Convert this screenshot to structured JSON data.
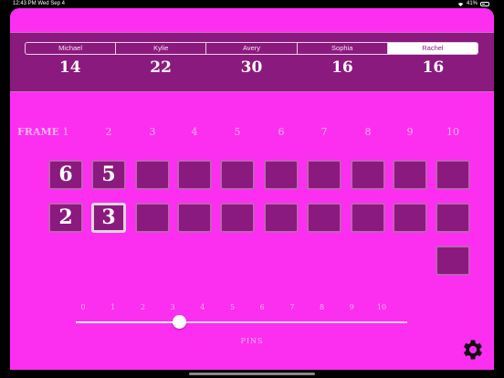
{
  "status": {
    "time": "12:43 PM",
    "date": "Wed Sep 4",
    "battery": "41%"
  },
  "players": [
    {
      "name": "Michael",
      "score": "14",
      "active": false
    },
    {
      "name": "Kylie",
      "score": "22",
      "active": false
    },
    {
      "name": "Avery",
      "score": "30",
      "active": false
    },
    {
      "name": "Sophia",
      "score": "16",
      "active": false
    },
    {
      "name": "Rachel",
      "score": "16",
      "active": true
    }
  ],
  "frames": {
    "label": "FRAME",
    "numbers": [
      "1",
      "2",
      "3",
      "4",
      "5",
      "6",
      "7",
      "8",
      "9",
      "10"
    ],
    "roll1": [
      "6",
      "5",
      "",
      "",
      "",
      "",
      "",
      "",
      "",
      ""
    ],
    "roll2": [
      "2",
      "3",
      "",
      "",
      "",
      "",
      "",
      "",
      "",
      ""
    ],
    "roll3": [
      ""
    ],
    "selected": {
      "row": 2,
      "frame": 2
    }
  },
  "pins": {
    "labels": [
      "0",
      "1",
      "2",
      "3",
      "4",
      "5",
      "6",
      "7",
      "8",
      "9",
      "10"
    ],
    "value": 3,
    "min": 0,
    "max": 10,
    "caption": "PINS"
  },
  "colors": {
    "background": "#fc2ef0",
    "panel": "#8b1a7e",
    "accent": "#ffffff"
  },
  "icons": {
    "settings": "gear-icon"
  }
}
